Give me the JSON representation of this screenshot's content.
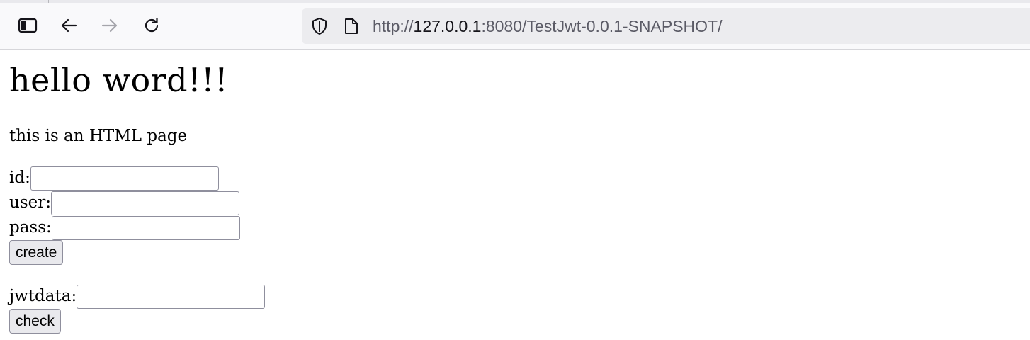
{
  "browser": {
    "url_prefix": "http://",
    "url_host": "127.0.0.1",
    "url_rest": ":8080/TestJwt-0.0.1-SNAPSHOT/",
    "icons": {
      "sidebar": "sidebar-icon",
      "back": "back-arrow-icon",
      "forward": "forward-arrow-icon",
      "reload": "reload-icon",
      "tracking_protection": "shield-icon",
      "page_info": "page-icon"
    },
    "forward_enabled": false
  },
  "page": {
    "heading": "hello word!!!",
    "intro": "this is an HTML page",
    "form_create": {
      "id_label": "id:",
      "id_value": "",
      "user_label": "user:",
      "user_value": "",
      "pass_label": "pass:",
      "pass_value": "",
      "button_label": "create"
    },
    "form_check": {
      "jwt_label": "jwtdata:",
      "jwt_value": "",
      "button_label": "check"
    }
  }
}
